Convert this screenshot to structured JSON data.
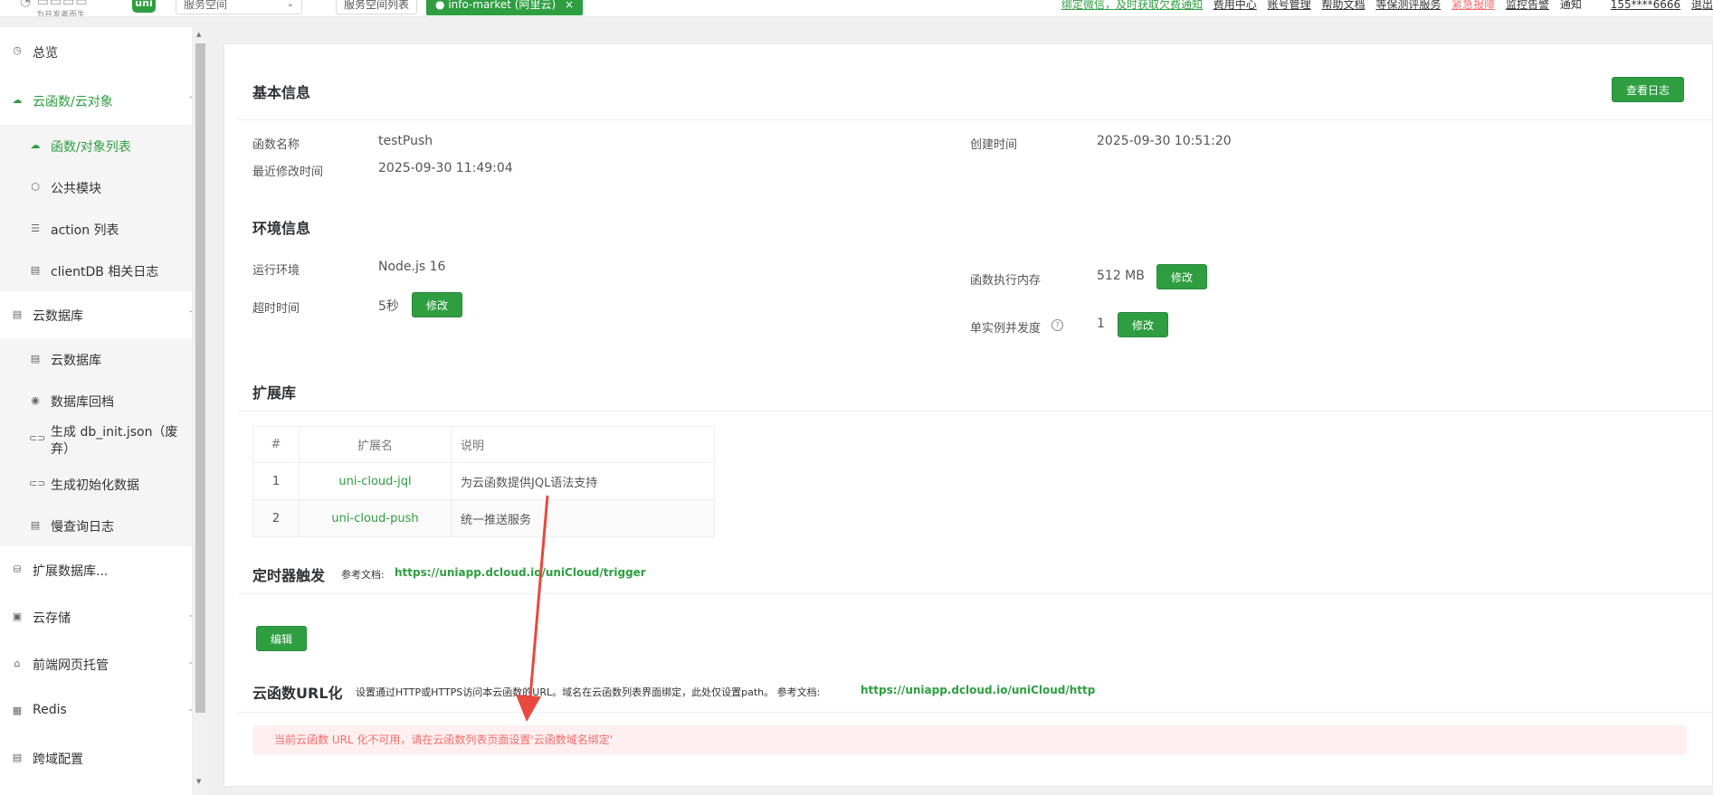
{
  "header": {
    "logo_tagline": "为开发者而生",
    "uni_badge": "uni",
    "space_select_value": "服务空间",
    "space_list_label": "服务空间列表",
    "space_tag": "info-market (阿里云)",
    "space_tag_close": "×",
    "links": {
      "bind_wechat": "绑定微信，及时获取欠费通知",
      "billing": "费用中心",
      "account": "账号管理",
      "help": "帮助文档",
      "security": "等保测评服务",
      "emergency": "紧急报障",
      "monitor": "监控告警",
      "notice": "通知",
      "user": "155****6666",
      "logout": "退出"
    }
  },
  "sidebar": {
    "overview": "总览",
    "cloud_functions": "云函数/云对象",
    "function_list": "函数/对象列表",
    "common_modules": "公共模块",
    "action_list": "action 列表",
    "clientdb_logs": "clientDB 相关日志",
    "cloud_db": "云数据库",
    "cloud_db_sub": "云数据库",
    "db_backup": "数据库回档",
    "gen_db_init": "生成 db_init.json（废弃）",
    "gen_init_data": "生成初始化数据",
    "slow_query": "慢查询日志",
    "ext_db": "扩展数据库...",
    "cloud_storage": "云存储",
    "web_hosting": "前端网页托管",
    "redis": "Redis",
    "cors": "跨域配置"
  },
  "basic": {
    "title": "基本信息",
    "view_logs": "查看日志",
    "name_label": "函数名称",
    "name_value": "testPush",
    "created_label": "创建时间",
    "created_value": "2025-09-30 10:51:20",
    "modified_label": "最近修改时间",
    "modified_value": "2025-09-30 11:49:04"
  },
  "env": {
    "title": "环境信息",
    "runtime_label": "运行环境",
    "runtime_value": "Node.js 16",
    "memory_label": "函数执行内存",
    "memory_value": "512 MB",
    "timeout_label": "超时时间",
    "timeout_value": "5秒",
    "concurrency_label": "单实例并发度",
    "concurrency_value": "1",
    "modify": "修改"
  },
  "ext": {
    "title": "扩展库",
    "col_index": "#",
    "col_name": "扩展名",
    "col_desc": "说明",
    "rows": [
      {
        "index": "1",
        "name": "uni-cloud-jql",
        "desc": "为云函数提供JQL语法支持"
      },
      {
        "index": "2",
        "name": "uni-cloud-push",
        "desc": "统一推送服务"
      }
    ]
  },
  "trigger": {
    "title": "定时器触发",
    "doc_label": "参考文档:",
    "doc_link": "https://uniapp.dcloud.io/uniCloud/trigger",
    "edit": "编辑"
  },
  "url": {
    "title": "云函数URL化",
    "desc": "设置通过HTTP或HTTPS访问本云函数的URL。域名在云函数列表界面绑定，此处仅设置path。 参考文档:",
    "doc_link": "https://uniapp.dcloud.io/uniCloud/http",
    "alert": "当前云函数 URL 化不可用，请在云函数列表页面设置'云函数域名绑定'"
  },
  "colors": {
    "accent": "#2e9e41",
    "alert_bg": "#fef0f0",
    "alert_text": "#f56c6c",
    "annotation_arrow": "#e8483e"
  }
}
